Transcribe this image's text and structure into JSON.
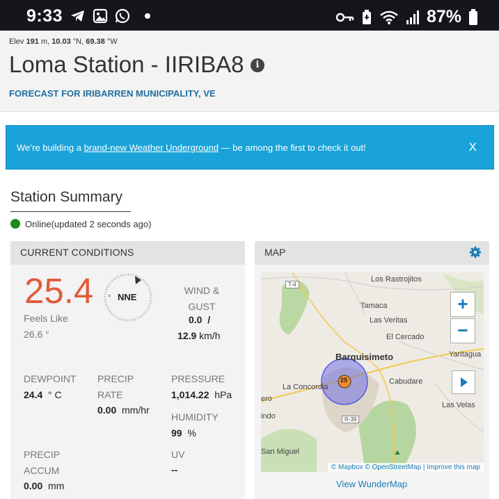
{
  "status_bar": {
    "time": "9:33",
    "battery": "87%"
  },
  "header": {
    "elev_label": "Elev",
    "elev_value": "191",
    "elev_unit": "m,",
    "lat_value": "10.03",
    "lat_unit": "°N,",
    "lon_value": "69.38",
    "lon_unit": "°W",
    "title": "Loma Station - IIRIBA8",
    "forecast_link": "FORECAST FOR IRIBARREN MUNICIPALITY, VE"
  },
  "banner": {
    "text_before": "We’re building a",
    "link": "brand-new Weather Underground",
    "text_after": " — be among the first to check it out!",
    "close": "X"
  },
  "summary": {
    "title": "Station Summary",
    "status": "Online(updated 2 seconds ago)"
  },
  "current": {
    "header": "CURRENT CONDITIONS",
    "temperature": "25.4",
    "temp_unit": "°",
    "feels_like_label": "Feels Like",
    "feels_like_value": "26.6 °",
    "wind_direction": "NNE",
    "wind_label": "WIND & GUST",
    "wind_speed": "0.0",
    "wind_sep": "/",
    "gust_speed": "12.9",
    "wind_unit": "km/h",
    "dewpoint_label": "DEWPOINT",
    "dewpoint_value": "24.4",
    "dewpoint_unit": "° C",
    "precip_rate_label": "PRECIP RATE",
    "precip_rate_value": "0.00",
    "precip_rate_unit": "mm/hr",
    "pressure_label": "PRESSURE",
    "pressure_value": "1,014.22",
    "pressure_unit": "hPa",
    "humidity_label": "HUMIDITY",
    "humidity_value": "99",
    "humidity_unit": "%",
    "precip_accum_label": "PRECIP ACCUM",
    "precip_accum_value": "0.00",
    "precip_accum_unit": "mm",
    "uv_label": "UV",
    "uv_value": "--"
  },
  "map": {
    "header": "MAP",
    "places": {
      "rastrojitos": "Los Rastrojitos",
      "tamaca": "Tamaca",
      "veritas": "Las Veritas",
      "cercado": "El Cercado",
      "barquisimeto": "Barquisimeto",
      "yaritagua": "Yaritagua",
      "concordia": "La Concordia",
      "cabudare": "Cabudare",
      "velas": "Las Velas",
      "ero": "ero",
      "indo": "indo",
      "sanmiguel": "San Miguel"
    },
    "road_t4": "T-4",
    "road_r39": "R-39",
    "marker_value": "25",
    "attribution": "© Mapbox © OpenStreetMap | Improve this map",
    "wundermap_link": "View WunderMap"
  },
  "colors": {
    "temperature": "#e05b3a",
    "link": "#1a7bb8",
    "banner": "#1aa3d9",
    "online": "#1c8a1c"
  }
}
